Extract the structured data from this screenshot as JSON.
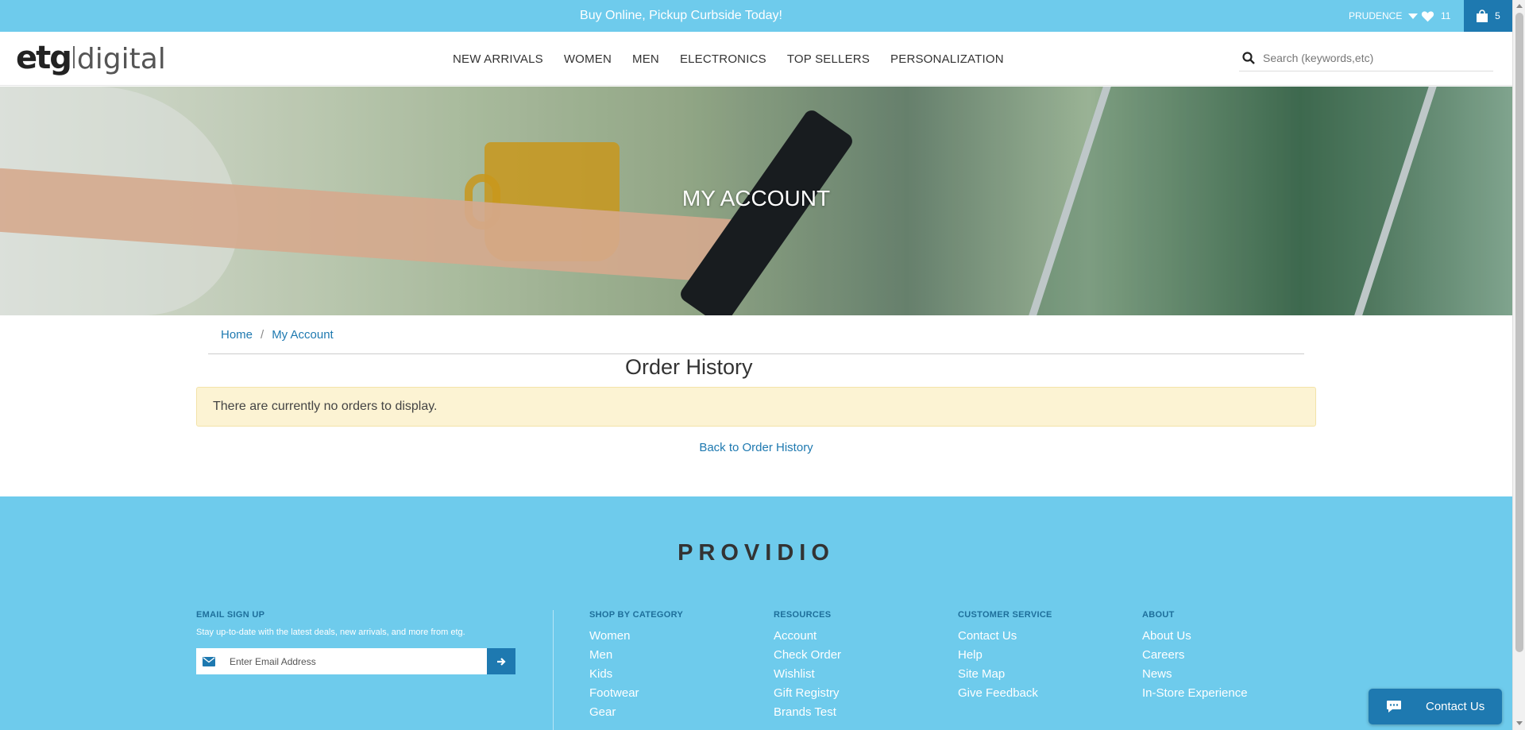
{
  "promo": {
    "text": "Buy Online, Pickup Curbside Today!",
    "user_name": "PRUDENCE",
    "wishlist_count": "11",
    "cart_count": "5"
  },
  "header": {
    "logo_primary": "etg",
    "logo_secondary": "digital",
    "nav": [
      "NEW ARRIVALS",
      "WOMEN",
      "MEN",
      "ELECTRONICS",
      "TOP SELLERS",
      "PERSONALIZATION"
    ],
    "search_placeholder": "Search (keywords,etc)"
  },
  "hero": {
    "title": "MY ACCOUNT"
  },
  "breadcrumb": {
    "home": "Home",
    "separator": "/",
    "current": "My Account"
  },
  "main": {
    "title": "Order History",
    "alert": "There are currently no orders to display.",
    "back_link": "Back to Order History"
  },
  "footer": {
    "brand": "PROVIDIO",
    "signup": {
      "heading": "EMAIL SIGN UP",
      "text": "Stay up-to-date with the latest deals, new arrivals, and more from etg.",
      "placeholder": "Enter Email Address"
    },
    "columns": [
      {
        "heading": "SHOP BY CATEGORY",
        "links": [
          "Women",
          "Men",
          "Kids",
          "Footwear",
          "Gear"
        ]
      },
      {
        "heading": "RESOURCES",
        "links": [
          "Account",
          "Check Order",
          "Wishlist",
          "Gift Registry",
          "Brands Test"
        ]
      },
      {
        "heading": "CUSTOMER SERVICE",
        "links": [
          "Contact Us",
          "Help",
          "Site Map",
          "Give Feedback"
        ]
      },
      {
        "heading": "ABOUT",
        "links": [
          "About Us",
          "Careers",
          "News",
          "In-Store Experience"
        ]
      }
    ]
  },
  "chat": {
    "label": "Contact Us"
  },
  "colors": {
    "accent": "#6ecbec",
    "link": "#1e79b0",
    "alert_bg": "#fcf3d3"
  },
  "icons": [
    "caret-down-icon",
    "heart-icon",
    "shopping-bag-icon",
    "search-icon",
    "envelope-icon",
    "arrow-right-icon",
    "chat-bubble-icon"
  ]
}
